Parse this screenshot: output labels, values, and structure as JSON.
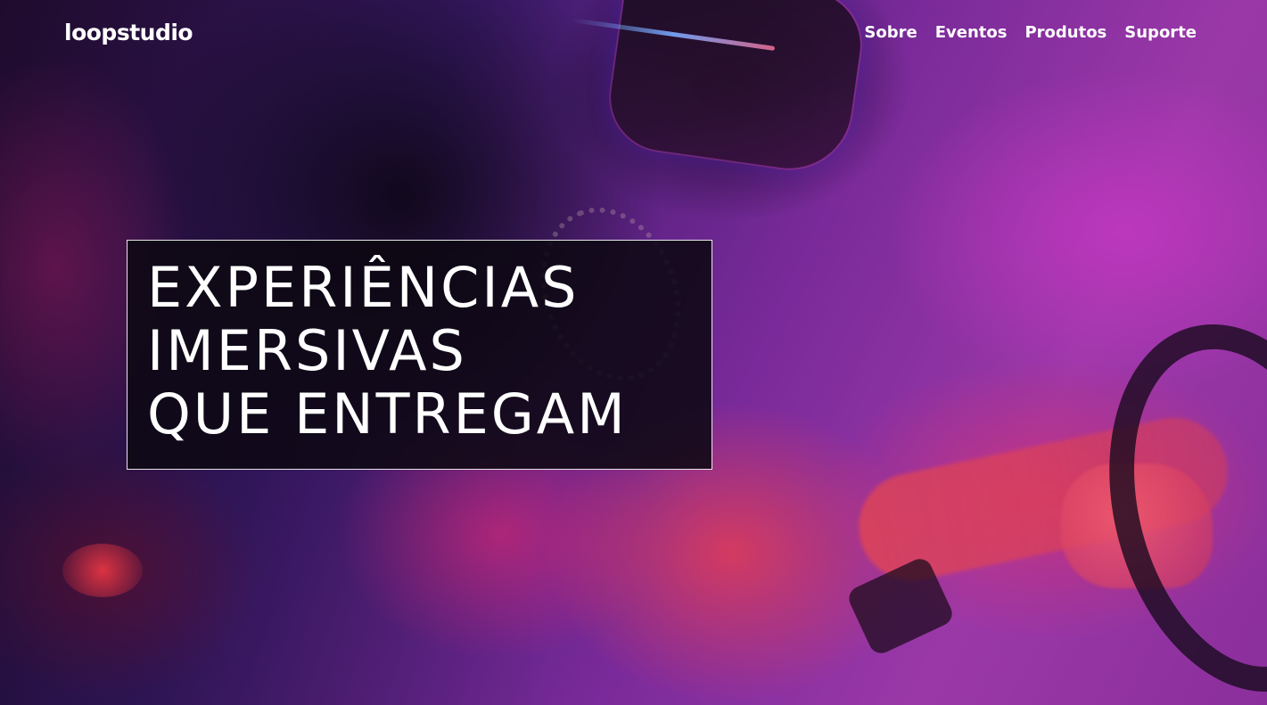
{
  "header": {
    "logo": "loopstudio",
    "nav": [
      {
        "label": "Sobre"
      },
      {
        "label": "Eventos"
      },
      {
        "label": "Produtos"
      },
      {
        "label": "Suporte"
      }
    ]
  },
  "hero": {
    "headline_lines": [
      "EXPERIÊNCIAS",
      "IMERSIVAS",
      "QUE ENTREGAM"
    ],
    "background": "vr-headset-photo"
  },
  "colors": {
    "text": "#ffffff",
    "headline_box_bg": "#0c0812",
    "overlay_magenta": "#9b38a8",
    "overlay_red": "#dc3c5a"
  }
}
